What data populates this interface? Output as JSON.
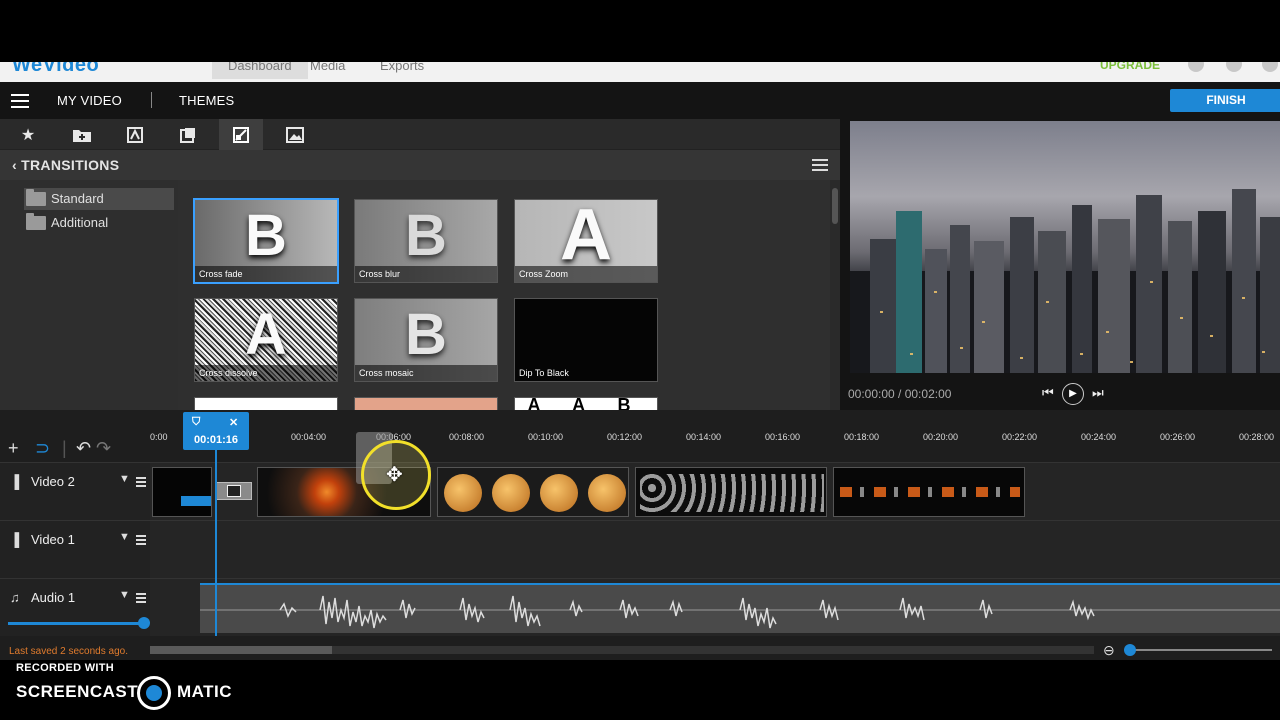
{
  "app": {
    "logo": "WeVideo",
    "top_nav": [
      "Dashboard",
      "Media",
      "Exports"
    ],
    "upgrade_label": "UPGRADE"
  },
  "header": {
    "my_video": "MY VIDEO",
    "themes": "THEMES",
    "finish": "FINISH"
  },
  "media_tabs": [
    "star-icon",
    "folder-add-icon",
    "text-icon",
    "graphics-icon",
    "transitions-icon",
    "image-icon"
  ],
  "transitions": {
    "title": "TRANSITIONS",
    "folders": [
      {
        "label": "Standard",
        "active": true
      },
      {
        "label": "Additional",
        "active": false
      }
    ],
    "tiles": [
      {
        "label": "Cross fade",
        "glyph": "B"
      },
      {
        "label": "Cross blur",
        "glyph": "B"
      },
      {
        "label": "Cross Zoom",
        "glyph": "A"
      },
      {
        "label": "Cross dissolve",
        "glyph": "A"
      },
      {
        "label": "Cross mosaic",
        "glyph": "B"
      },
      {
        "label": "Dip To Black",
        "glyph": ""
      },
      {
        "label": "",
        "glyph": ""
      },
      {
        "label": "",
        "glyph": ""
      },
      {
        "label": "",
        "glyph": "A A B"
      }
    ]
  },
  "preview": {
    "time": "00:00:00 / 00:02:00"
  },
  "timeline": {
    "playhead_time": "00:01:16",
    "ticks": [
      "0:00",
      "00:04:00",
      "00:06:00",
      "00:08:00",
      "00:10:00",
      "00:12:00",
      "00:14:00",
      "00:16:00",
      "00:18:00",
      "00:20:00",
      "00:22:00",
      "00:24:00",
      "00:26:00",
      "00:28:00"
    ],
    "tracks": [
      {
        "name": "Video 2",
        "icon": "film-icon"
      },
      {
        "name": "Video 1",
        "icon": "film-icon"
      },
      {
        "name": "Audio 1",
        "icon": "music-icon"
      }
    ]
  },
  "status": {
    "saved": "Last saved 2 seconds ago."
  },
  "watermark": {
    "recorded_with": "RECORDED WITH",
    "brand_left": "SCREENCAST",
    "brand_right": "MATIC"
  },
  "colors": {
    "accent": "#1e88d6",
    "saved_text": "#e07b2d",
    "cursor_highlight": "#f2e02a"
  }
}
